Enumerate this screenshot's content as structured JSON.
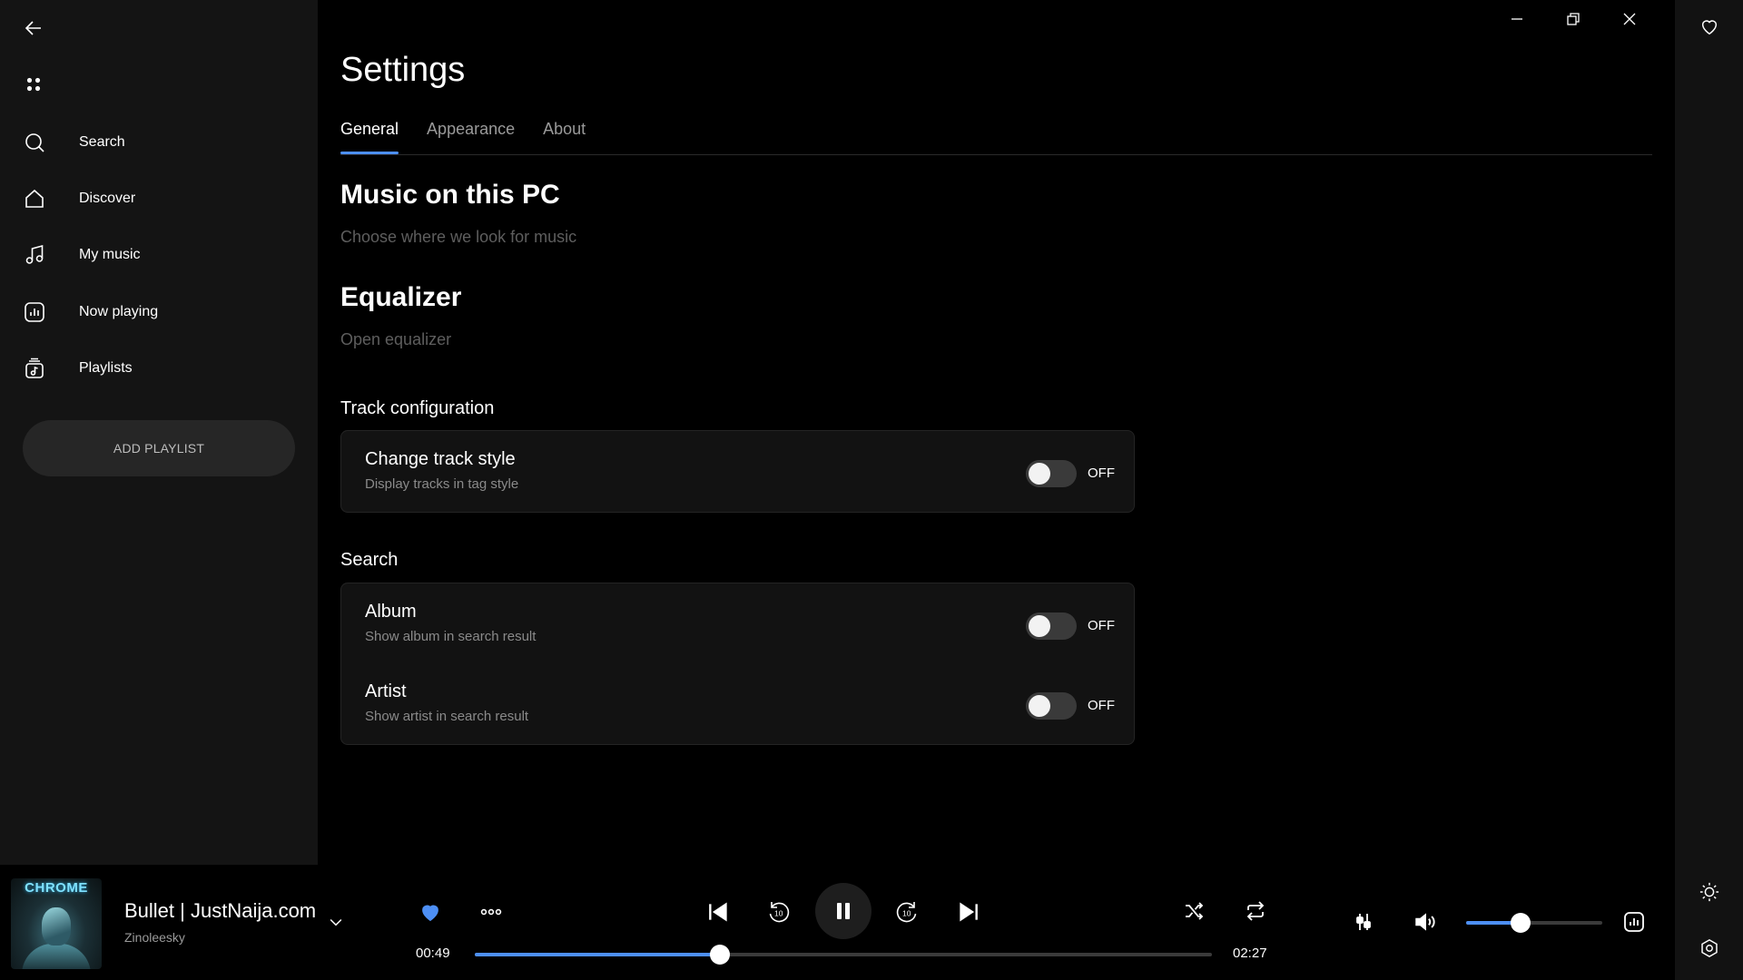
{
  "window": {
    "minimize_icon": "minimize-icon",
    "restore_icon": "restore-icon",
    "close_icon": "close-icon"
  },
  "sidebar": {
    "back_icon": "back-arrow-icon",
    "menu_icon": "apps-dots-icon",
    "items": [
      {
        "label": "Search",
        "icon": "search-icon"
      },
      {
        "label": "Discover",
        "icon": "home-icon"
      },
      {
        "label": "My music",
        "icon": "music-note-icon"
      },
      {
        "label": "Now playing",
        "icon": "now-playing-icon"
      },
      {
        "label": "Playlists",
        "icon": "playlist-icon"
      }
    ],
    "add_playlist_label": "ADD PLAYLIST"
  },
  "header": {
    "title": "Settings",
    "tabs": [
      {
        "label": "General",
        "active": true
      },
      {
        "label": "Appearance",
        "active": false
      },
      {
        "label": "About",
        "active": false
      }
    ]
  },
  "main": {
    "music_pc": {
      "title": "Music on this PC",
      "subtitle": "Choose where we look for music"
    },
    "equalizer": {
      "title": "Equalizer",
      "subtitle": "Open equalizer"
    },
    "track_config": {
      "heading": "Track configuration",
      "rows": [
        {
          "title": "Change track style",
          "desc": "Display tracks in tag style",
          "state": "OFF"
        }
      ]
    },
    "search": {
      "heading": "Search",
      "rows": [
        {
          "title": "Album",
          "desc": "Show album in search result",
          "state": "OFF"
        },
        {
          "title": "Artist",
          "desc": "Show artist in search result",
          "state": "OFF"
        }
      ]
    }
  },
  "rail": {
    "favorite_icon": "heart-outline-icon",
    "theme_icon": "brightness-icon",
    "settings_icon": "settings-hex-icon"
  },
  "player": {
    "album_art_text": "CHROME",
    "track_title": "Bullet | JustNaija.com",
    "artist": "Zinoleesky",
    "elapsed": "00:49",
    "total": "02:27",
    "progress": 0.333,
    "volume": 0.4,
    "accent_color": "#4d8ff5"
  }
}
